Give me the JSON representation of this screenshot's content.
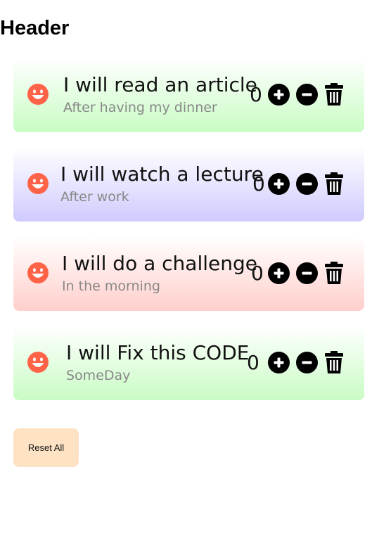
{
  "header": {
    "title": "Header"
  },
  "items": [
    {
      "title": "I will read an article",
      "subtitle": "After having my dinner",
      "count": "0",
      "color": "#c9fcc4"
    },
    {
      "title": "I will watch a lecture",
      "subtitle": "After work",
      "count": "0",
      "color": "#cfcbfe"
    },
    {
      "title": "I will do a challenge",
      "subtitle": "In the morning",
      "count": "0",
      "color": "#ffcfcb"
    },
    {
      "title": "I will Fix this CODE",
      "subtitle": "SomeDay",
      "count": "0",
      "color": "#c9fcc4"
    }
  ],
  "icons": {
    "face": "smiley-icon",
    "plus": "plus-circle-icon",
    "minus": "minus-circle-icon",
    "delete": "trash-icon"
  },
  "accent_colors": {
    "smiley": "#ff6347",
    "reset_button": "#fde2c4"
  },
  "reset": {
    "label": "Reset All"
  }
}
